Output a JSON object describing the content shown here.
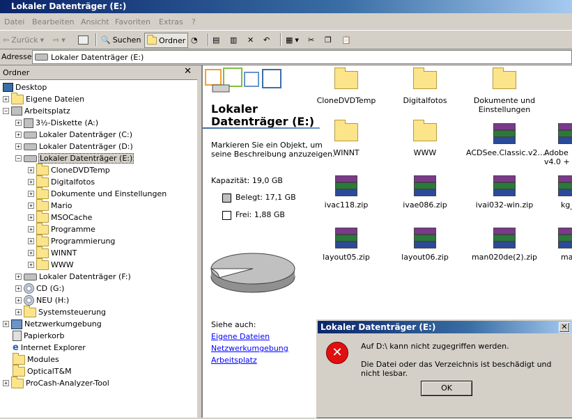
{
  "window": {
    "title": "Lokaler Datenträger (E:)"
  },
  "menu": [
    "Datei",
    "Bearbeiten",
    "Ansicht",
    "Favoriten",
    "Extras",
    "?"
  ],
  "toolbar": {
    "back": "Zurück",
    "search": "Suchen",
    "folders": "Ordner"
  },
  "address": {
    "label": "Adresse",
    "value": "Lokaler Datenträger (E:)"
  },
  "folders_pane": {
    "title": "Ordner",
    "close": "✕",
    "items": [
      {
        "label": "Desktop"
      },
      {
        "label": "Eigene Dateien"
      },
      {
        "label": "Arbeitsplatz"
      },
      {
        "label": "3½-Diskette (A:)"
      },
      {
        "label": "Lokaler Datenträger (C:)"
      },
      {
        "label": "Lokaler Datenträger (D:)"
      },
      {
        "label": "Lokaler Datenträger (E:)"
      },
      {
        "label": "CloneDVDTemp"
      },
      {
        "label": "Digitalfotos"
      },
      {
        "label": "Dokumente und Einstellungen"
      },
      {
        "label": "Mario"
      },
      {
        "label": "MSOCache"
      },
      {
        "label": "Programme"
      },
      {
        "label": "Programmierung"
      },
      {
        "label": "WINNT"
      },
      {
        "label": "WWW"
      },
      {
        "label": "Lokaler Datenträger (F:)"
      },
      {
        "label": "CD (G:)"
      },
      {
        "label": "NEU (H:)"
      },
      {
        "label": "Systemsteuerung"
      },
      {
        "label": "Netzwerkumgebung"
      },
      {
        "label": "Papierkorb"
      },
      {
        "label": "Internet Explorer"
      },
      {
        "label": "Modules"
      },
      {
        "label": "OpticalT&M"
      },
      {
        "label": "ProCash-Analyzer-Tool"
      }
    ]
  },
  "info_panel": {
    "title_line1": "Lokaler",
    "title_line2": "Datenträger (E:)",
    "description_line1": "Markieren Sie ein Objekt, um",
    "description_line2": "seine Beschreibung anzuzeigen.",
    "capacity": "Kapazität: 19,0 GB",
    "used": "Belegt: 17,1 GB",
    "free": "Frei: 1,88 GB",
    "used_fraction": 0.9,
    "see_also": "Siehe auch:",
    "links": [
      "Eigene Dateien",
      "Netzwerkumgebung",
      "Arbeitsplatz"
    ],
    "colors": {
      "used": "#c0c0c0",
      "free": "#ffffff"
    }
  },
  "files": [
    {
      "name": "CloneDVDTemp",
      "kind": "folder"
    },
    {
      "name": "Digitalfotos",
      "kind": "folder"
    },
    {
      "name": "Dokumente und Einstellungen",
      "kind": "folder"
    },
    {
      "name": "WINNT",
      "kind": "folder"
    },
    {
      "name": "WWW",
      "kind": "folder"
    },
    {
      "name": "ACDSee.Classic.v2....",
      "kind": "archive"
    },
    {
      "name": "Adobe v4.0 +",
      "kind": "archive"
    },
    {
      "name": "ivac118.zip",
      "kind": "archive"
    },
    {
      "name": "ivae086.zip",
      "kind": "archive"
    },
    {
      "name": "ivai032-win.zip",
      "kind": "archive"
    },
    {
      "name": "kg_",
      "kind": "archive"
    },
    {
      "name": "layout05.zip",
      "kind": "archive"
    },
    {
      "name": "layout06.zip",
      "kind": "archive"
    },
    {
      "name": "man020de(2).zip",
      "kind": "archive"
    },
    {
      "name": "mar",
      "kind": "archive"
    }
  ],
  "dialog": {
    "title": "Lokaler Datenträger (E:)",
    "close": "✕",
    "icon": "✕",
    "message1": "Auf D:\\ kann nicht zugegriffen werden.",
    "message2": "Die Datei oder das Verzeichnis ist beschädigt und nicht lesbar.",
    "ok": "OK"
  }
}
